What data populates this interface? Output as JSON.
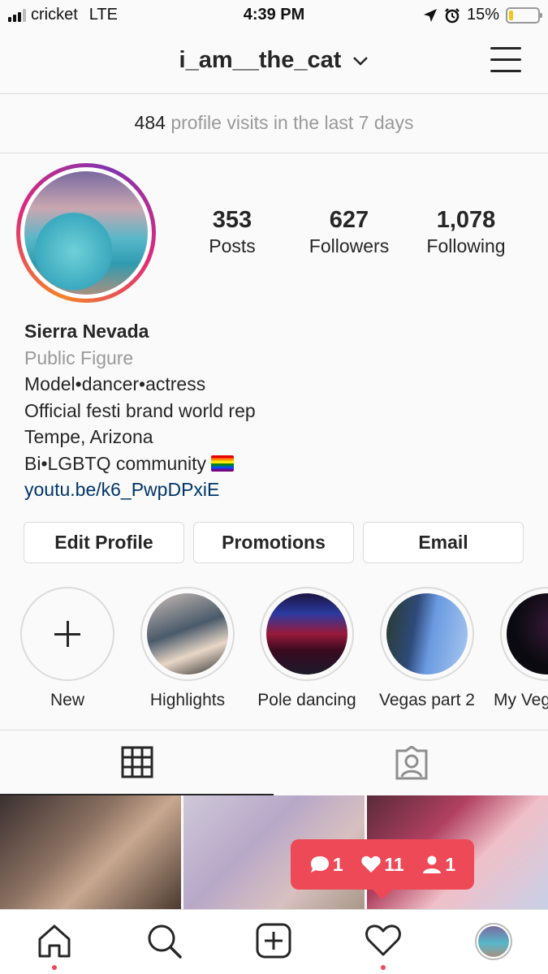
{
  "status_bar": {
    "carrier": "cricket",
    "network": "LTE",
    "time": "4:39 PM",
    "battery": "15%",
    "battery_level": 0.15
  },
  "header": {
    "username": "i_am__the_cat"
  },
  "visits": {
    "count": "484",
    "text": "profile visits in the last 7 days"
  },
  "stats": {
    "posts": {
      "value": "353",
      "label": "Posts"
    },
    "followers": {
      "value": "627",
      "label": "Followers"
    },
    "following": {
      "value": "1,078",
      "label": "Following"
    }
  },
  "bio": {
    "name": "Sierra Nevada",
    "category": "Public Figure",
    "line1": "Model•dancer•actress",
    "line2": "Official festi brand world rep",
    "line3": "Tempe, Arizona",
    "line4": "Bi•LGBTQ community",
    "link": "youtu.be/k6_PwpDPxiE"
  },
  "buttons": {
    "edit_profile": "Edit Profile",
    "promotions": "Promotions",
    "email": "Email"
  },
  "highlights": [
    {
      "label": "New"
    },
    {
      "label": "Highlights"
    },
    {
      "label": "Pole dancing"
    },
    {
      "label": "Vegas part 2"
    },
    {
      "label": "My Veg"
    }
  ],
  "activity": {
    "comments": "1",
    "likes": "11",
    "follows": "1"
  },
  "colors": {
    "notification": "#ed4956",
    "link": "#003569",
    "border": "#dbdbdb"
  },
  "icons": [
    "home-icon",
    "search-icon",
    "add-post-icon",
    "heart-icon",
    "grid-icon",
    "tagged-icon",
    "menu-icon"
  ]
}
